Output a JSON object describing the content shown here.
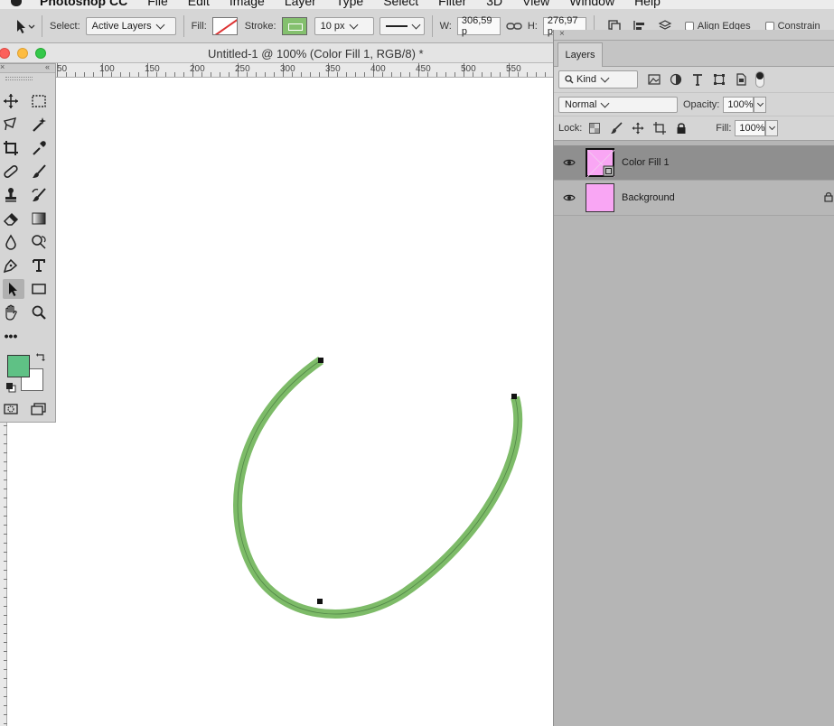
{
  "menubar": {
    "app_name": "Photoshop CC",
    "items": [
      "File",
      "Edit",
      "Image",
      "Layer",
      "Type",
      "Select",
      "Filter",
      "3D",
      "View",
      "Window",
      "Help"
    ]
  },
  "options_bar": {
    "select_label": "Select:",
    "select_value": "Active Layers",
    "fill_label": "Fill:",
    "stroke_label": "Stroke:",
    "stroke_width": "10 px",
    "w_label": "W:",
    "w_value": "306,59 p",
    "h_label": "H:",
    "h_value": "276,97 p",
    "align_edges_label": "Align Edges",
    "constrain_label": "Constrain"
  },
  "document": {
    "title": "Untitled-1 @ 100% (Color Fill 1, RGB/8) *",
    "ruler_labels": [
      "50",
      "100",
      "150",
      "200",
      "250",
      "300",
      "350",
      "400",
      "450",
      "500",
      "550"
    ]
  },
  "tools_panel": {
    "foreground_color": "#5fc185",
    "background_color": "#ffffff",
    "more_label": "•••"
  },
  "path": {
    "stroke_color": "#7dbb68"
  },
  "layers_panel": {
    "tab_label": "Layers",
    "filter_kind": "Kind",
    "blend_mode": "Normal",
    "opacity_label": "Opacity:",
    "opacity_value": "100%",
    "lock_label": "Lock:",
    "fill_label": "Fill:",
    "fill_value": "100%",
    "layers": [
      {
        "name": "Color Fill 1",
        "thumb_color": "#f9a6f4"
      },
      {
        "name": "Background",
        "thumb_color": "#f9a6f4"
      }
    ]
  }
}
